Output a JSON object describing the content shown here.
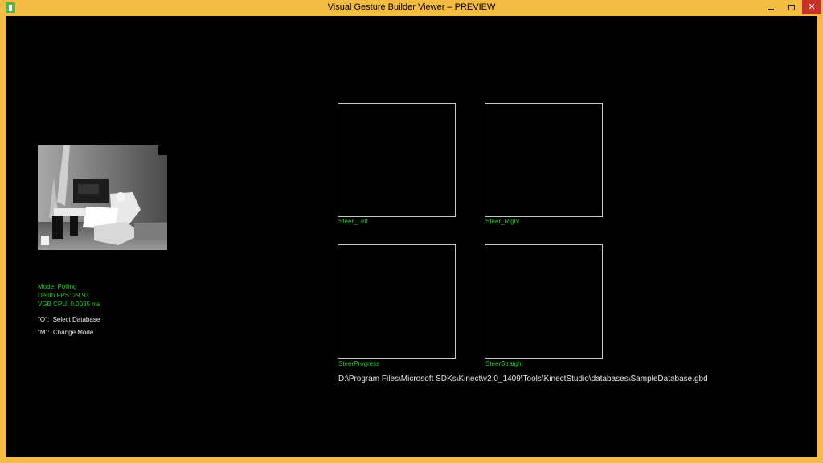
{
  "window": {
    "title": "Visual Gesture Builder Viewer – PREVIEW",
    "buttons": {
      "minimize": "minimize",
      "maximize": "maximize",
      "close": "✕"
    }
  },
  "status": {
    "mode": "Mode: Polling",
    "depth_fps": "Depth FPS: 29.93",
    "vgb_cpu": "VGB CPU: 0.0035 ms"
  },
  "hints": {
    "select_database": "\"O\":  Select Database",
    "change_mode": "\"M\":  Change Mode"
  },
  "gestures": {
    "steer_left": "Steer_Left",
    "steer_right": "Steer_Right",
    "steer_progress": "SteerProgress",
    "steer_straight": "SteerStraight"
  },
  "database_path": "D:\\Program Files\\Microsoft SDKs\\Kinect\\v2.0_1409\\Tools\\KinectStudio\\databases\\SampleDatabase.gbd",
  "colors": {
    "frame": "#f4bc43",
    "background": "#000000",
    "status_text": "#22c52b",
    "close_button": "#c7302b"
  }
}
